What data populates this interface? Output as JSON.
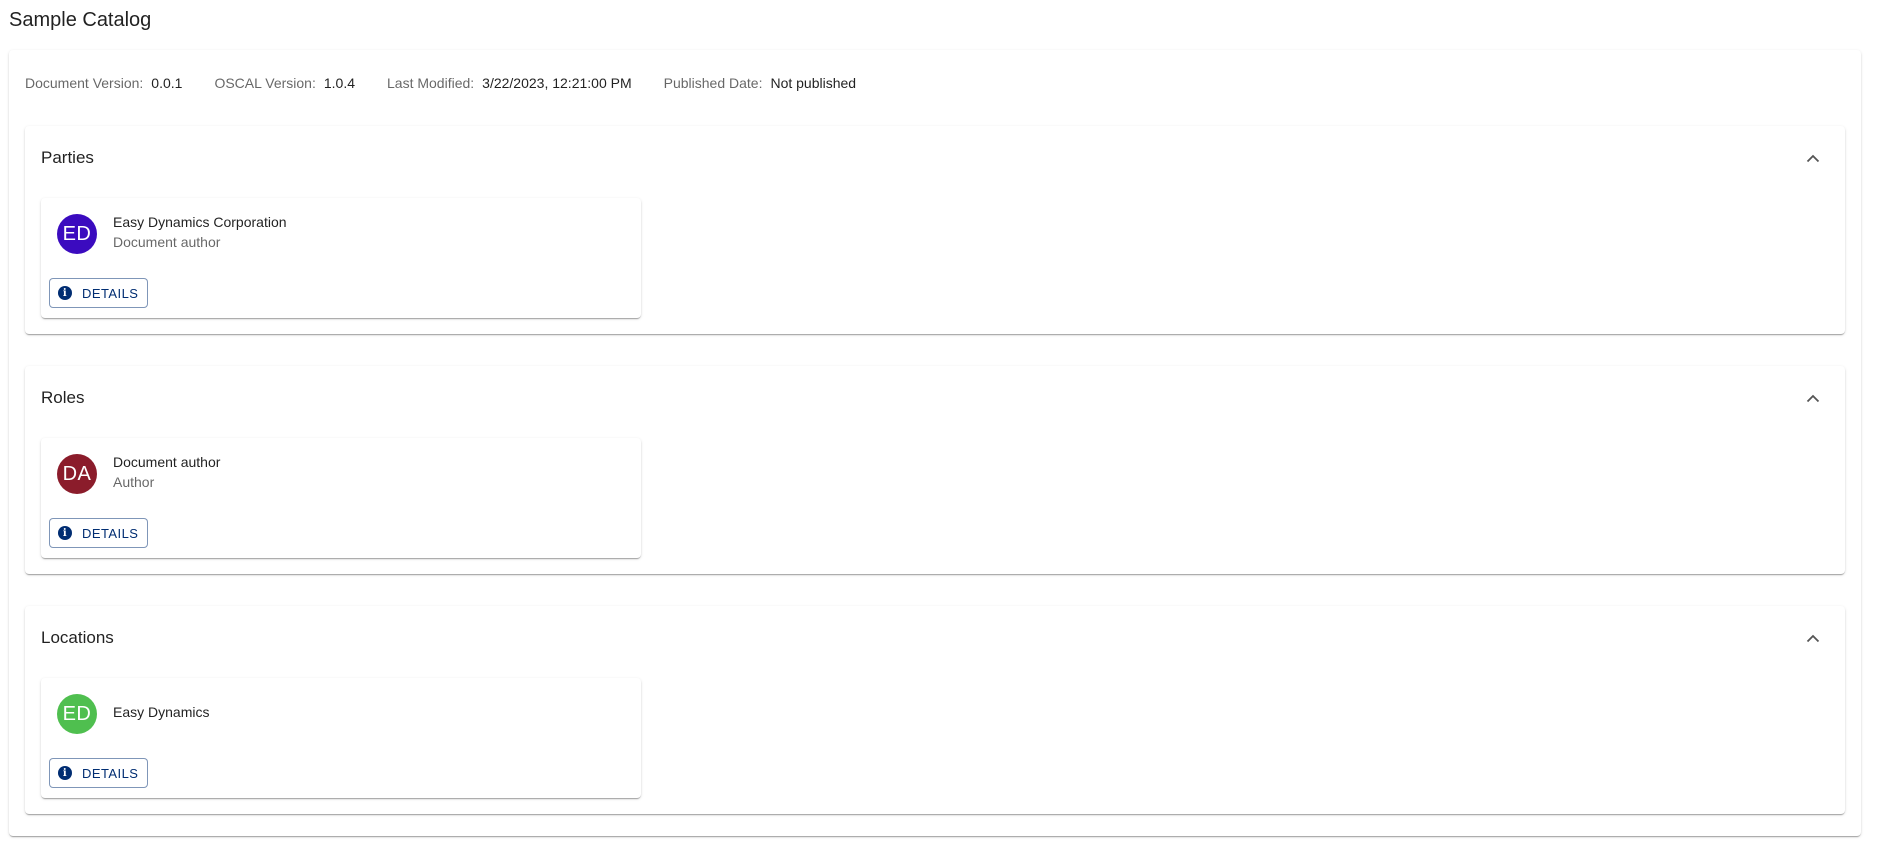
{
  "page": {
    "title": "Sample Catalog"
  },
  "metadata": [
    {
      "label": "Document Version:",
      "value": "0.0.1"
    },
    {
      "label": "OSCAL Version:",
      "value": "1.0.4"
    },
    {
      "label": "Last Modified:",
      "value": "3/22/2023, 12:21:00 PM"
    },
    {
      "label": "Published Date:",
      "value": "Not published"
    }
  ],
  "sections": [
    {
      "title": "Parties",
      "expanded": true,
      "cards": [
        {
          "initials": "ED",
          "avatar_color": "#3b0bbf",
          "title": "Easy Dynamics Corporation",
          "subtitle": "Document author",
          "button_label": "DETAILS"
        }
      ]
    },
    {
      "title": "Roles",
      "expanded": true,
      "cards": [
        {
          "initials": "DA",
          "avatar_color": "#8b1c2b",
          "title": "Document author",
          "subtitle": "Author",
          "button_label": "DETAILS"
        }
      ]
    },
    {
      "title": "Locations",
      "expanded": true,
      "cards": [
        {
          "initials": "ED",
          "avatar_color": "#4fbf4f",
          "title": "Easy Dynamics",
          "subtitle": "",
          "button_label": "DETAILS"
        }
      ]
    }
  ],
  "icons": {
    "collapse": "chevron-up-icon",
    "info": "info-icon"
  },
  "colors": {
    "primary": "#002d72"
  }
}
